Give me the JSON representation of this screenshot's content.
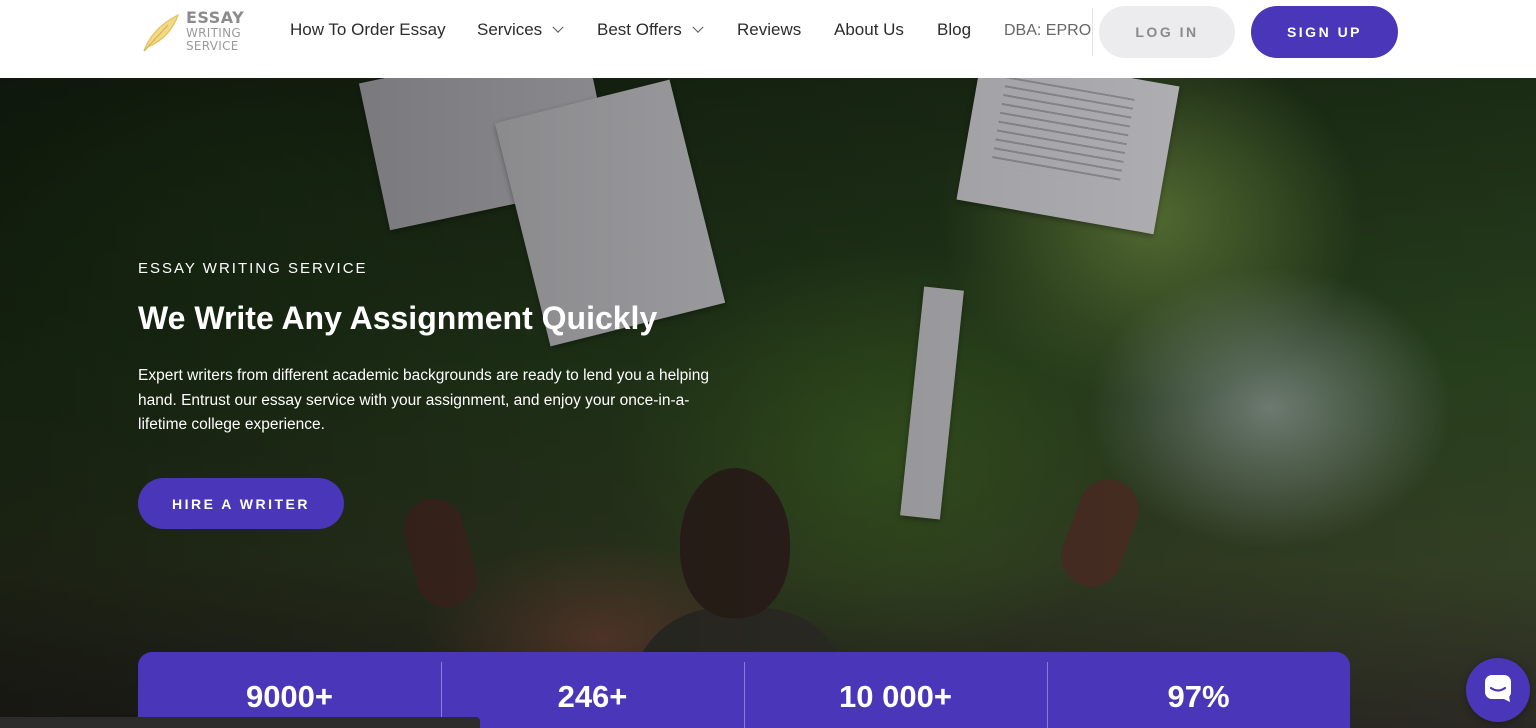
{
  "logo": {
    "line1": "ESSAY",
    "line2": "WRITING",
    "line3": "SERVICE",
    "icon": "quill-icon"
  },
  "nav": {
    "items": [
      {
        "label": "How To Order Essay",
        "has_dropdown": false
      },
      {
        "label": "Services",
        "has_dropdown": true
      },
      {
        "label": "Best Offers",
        "has_dropdown": true
      },
      {
        "label": "Reviews",
        "has_dropdown": false
      },
      {
        "label": "About Us",
        "has_dropdown": false
      },
      {
        "label": "Blog",
        "has_dropdown": false
      }
    ],
    "dba": "DBA: EPRO",
    "login": "LOG IN",
    "signup": "SIGN UP"
  },
  "hero": {
    "eyebrow": "ESSAY WRITING SERVICE",
    "title": "We Write Any Assignment Quickly",
    "description": "Expert writers from different academic backgrounds are ready to lend you a helping hand. Entrust our essay service with your assignment, and enjoy your once-in-a-lifetime college experience.",
    "cta": "HIRE A WRITER"
  },
  "stats": [
    {
      "value": "9000+"
    },
    {
      "value": "246+"
    },
    {
      "value": "10 000+"
    },
    {
      "value": "97%"
    }
  ],
  "chat": {
    "icon": "chat-icon"
  },
  "colors": {
    "brand": "#4a36b8",
    "login_bg": "#ececef"
  }
}
